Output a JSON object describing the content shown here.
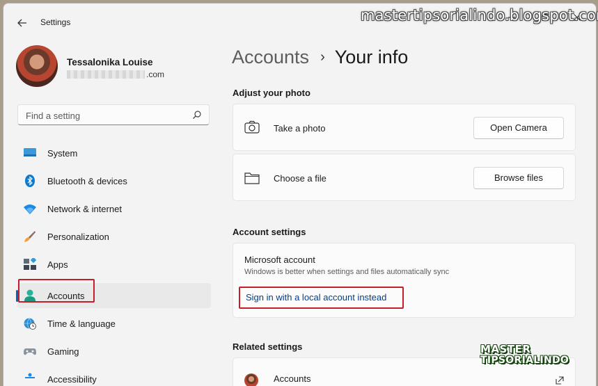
{
  "window": {
    "title": "Settings",
    "watermark": "mastertipsorialindo.blogspot.com"
  },
  "profile": {
    "name": "Tessalonika Louise",
    "email_suffix": ".com"
  },
  "search": {
    "placeholder": "Find a setting"
  },
  "nav": {
    "items": [
      {
        "label": "System",
        "icon": "monitor-icon"
      },
      {
        "label": "Bluetooth & devices",
        "icon": "bluetooth-icon"
      },
      {
        "label": "Network & internet",
        "icon": "wifi-icon"
      },
      {
        "label": "Personalization",
        "icon": "brush-icon"
      },
      {
        "label": "Apps",
        "icon": "apps-icon"
      },
      {
        "label": "Accounts",
        "icon": "person-icon",
        "selected": true
      },
      {
        "label": "Time & language",
        "icon": "globe-clock-icon"
      },
      {
        "label": "Gaming",
        "icon": "gamepad-icon"
      },
      {
        "label": "Accessibility",
        "icon": "accessibility-icon"
      }
    ]
  },
  "breadcrumb": {
    "parent": "Accounts",
    "separator": "›",
    "current": "Your info"
  },
  "photo": {
    "heading": "Adjust your photo",
    "take_label": "Take a photo",
    "take_button": "Open Camera",
    "file_label": "Choose a file",
    "file_button": "Browse files"
  },
  "account_settings": {
    "heading": "Account settings",
    "ms_title": "Microsoft account",
    "ms_desc": "Windows is better when settings and files automatically sync",
    "link": "Sign in with a local account instead"
  },
  "related": {
    "heading": "Related settings",
    "first_item": "Accounts"
  },
  "logo": {
    "line1": "MASTER",
    "line2": "TIPSORIALINDO"
  },
  "colors": {
    "accent": "#0067c0",
    "highlight": "#c41e2a",
    "link": "#003e92"
  }
}
